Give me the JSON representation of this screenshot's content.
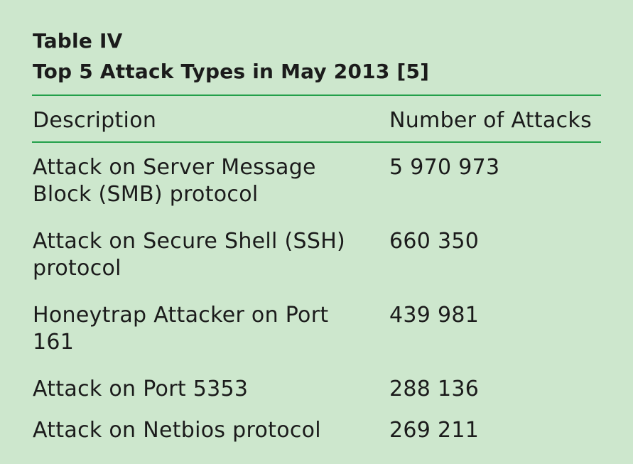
{
  "table": {
    "label": "Table IV",
    "title": "Top 5 Attack Types in May 2013 [5]",
    "headers": {
      "description": "Description",
      "count": "Number of Attacks"
    },
    "rows": [
      {
        "description": "Attack on Server Message Block (SMB) protocol",
        "count": "5 970 973"
      },
      {
        "description": "Attack on Secure Shell (SSH) protocol",
        "count": "660 350"
      },
      {
        "description": "Honeytrap Attacker on Port 161",
        "count": "439 981"
      },
      {
        "description": "Attack on Port 5353",
        "count": "288 136"
      },
      {
        "description": "Attack on Netbios protocol",
        "count": "269 211"
      }
    ]
  },
  "colors": {
    "background": "#cde7cd",
    "rule": "#22a04a",
    "text": "#1b1b1b"
  }
}
